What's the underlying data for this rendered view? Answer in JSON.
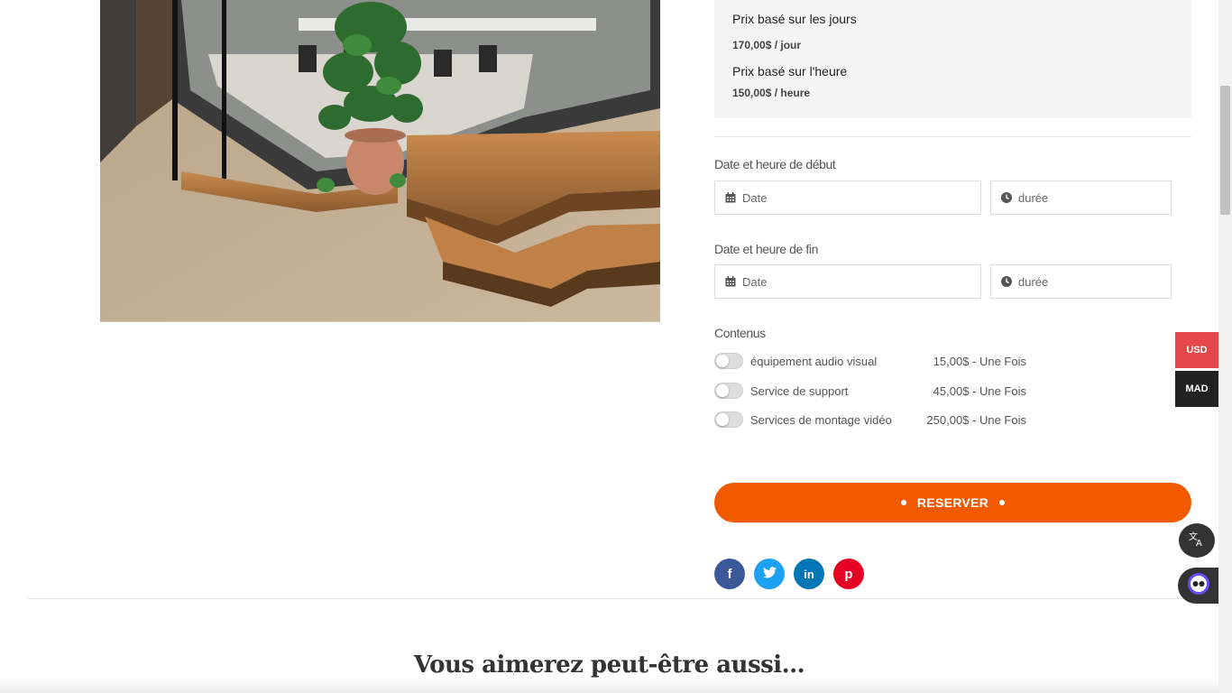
{
  "pricing": {
    "day_title": "Prix basé sur les jours",
    "day_value": "170,00$ / jour",
    "hour_title": "Prix basé sur l'heure",
    "hour_value": "150,00$ / heure"
  },
  "booking": {
    "start_label": "Date et heure de début",
    "end_label": "Date et heure de fin",
    "date_placeholder": "Date",
    "duration_placeholder": "durée"
  },
  "extras": {
    "label": "Contenus",
    "items": [
      {
        "name": "équipement audio visual",
        "price": "15,00$ - Une Fois",
        "enabled": false
      },
      {
        "name": "Service de support",
        "price": "45,00$ - Une Fois",
        "enabled": false
      },
      {
        "name": "Services de montage vidéo",
        "price": "250,00$ - Une Fois",
        "enabled": false
      }
    ]
  },
  "reserve_label": "RESERVER",
  "social": {
    "facebook": "f",
    "twitter": "t",
    "linkedin": "in",
    "pinterest": "p"
  },
  "related_title": "Vous aimerez peut-être aussi…",
  "currency": {
    "usd": "USD",
    "mad": "MAD"
  },
  "colors": {
    "accent": "#f15a00",
    "usd_bg": "#e5474b",
    "mad_bg": "#222222",
    "facebook": "#3b5998",
    "twitter": "#1da1f2",
    "linkedin": "#0077b5",
    "pinterest": "#e60023"
  }
}
